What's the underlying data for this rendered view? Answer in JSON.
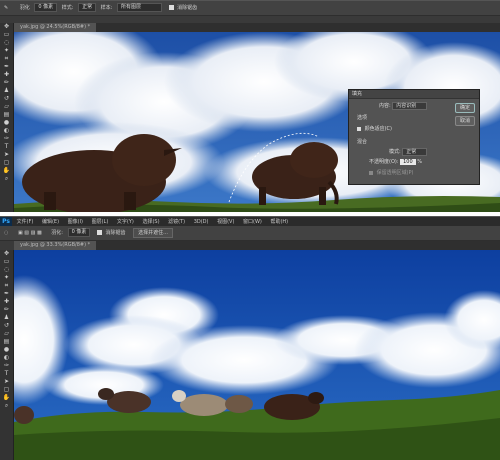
{
  "shot1": {
    "options": {
      "feather_label": "羽化",
      "feather_value": "0 像素",
      "style_label": "样式:",
      "style_value": "正常",
      "sample_label": "样本:",
      "sample_value": "所有图层",
      "checkbox_label": "消除锯齿"
    },
    "tab_label": "yak.jpg @ 24.5%(RGB/8#) *",
    "dialog": {
      "title": "填充",
      "contents_label": "内容:",
      "contents_value": "内容识别",
      "options_label": "选项",
      "color_adapt_label": "颜色适应(C)",
      "blend_label": "混合",
      "mode_label": "模式:",
      "mode_value": "正常",
      "opacity_label": "不透明度(O):",
      "opacity_value": "100",
      "opacity_unit": "%",
      "preserve_label": "保留透明区域(P)",
      "ok_label": "确定",
      "cancel_label": "取消"
    }
  },
  "shot2": {
    "app_logo": "Ps",
    "menu": [
      "文件(F)",
      "编辑(E)",
      "图像(I)",
      "图层(L)",
      "文字(Y)",
      "选择(S)",
      "滤镜(T)",
      "3D(D)",
      "视图(V)",
      "窗口(W)",
      "帮助(H)"
    ],
    "options": {
      "feather_label": "羽化:",
      "feather_value": "0 像素",
      "checkbox_label": "消除锯齿",
      "select_mask_label": "选择并遮住..."
    },
    "tab_label": "yak.jpg @ 33.3%(RGB/8#) *"
  }
}
